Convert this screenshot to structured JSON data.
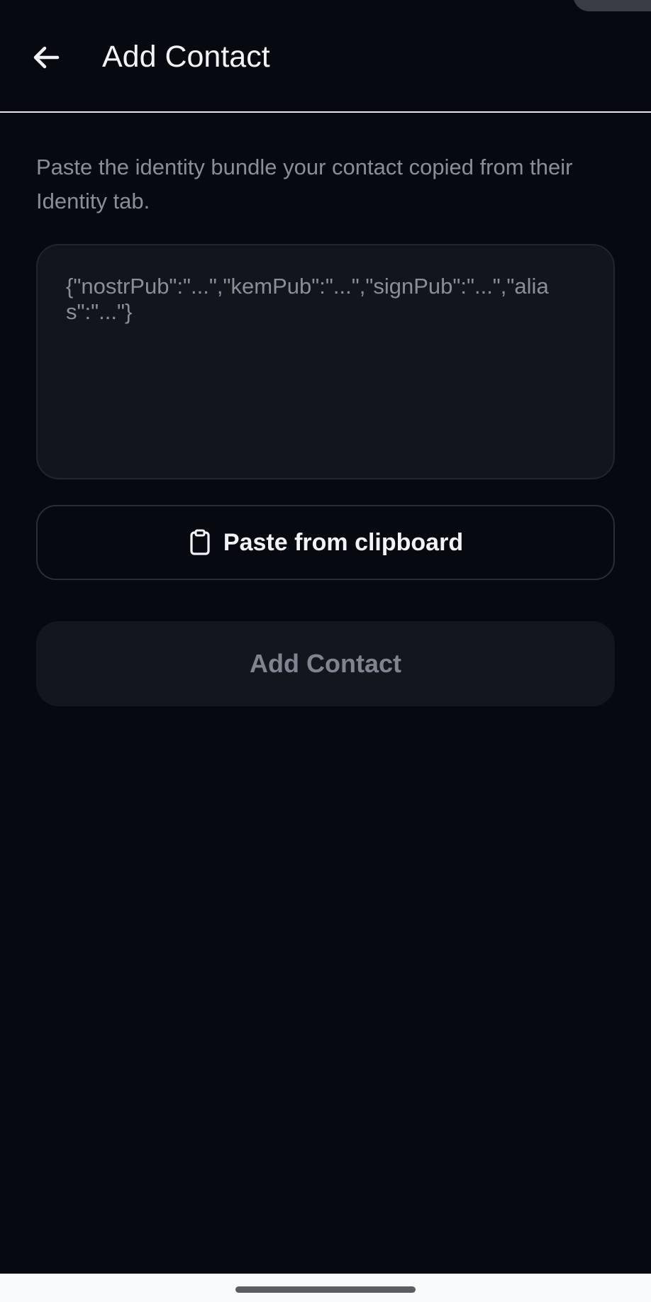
{
  "app_bar": {
    "title": "Add Contact",
    "back_icon": "arrow-left-icon"
  },
  "description": "Paste the identity bundle your contact copied from their Identity tab.",
  "bundle_input": {
    "value": "",
    "placeholder": "{\"nostrPub\":\"...\",\"kemPub\":\"...\",\"signPub\":\"...\",\"alias\":\"...\"}"
  },
  "paste_button": {
    "label": "Paste from clipboard",
    "icon": "clipboard-icon"
  },
  "add_button": {
    "label": "Add Contact",
    "enabled": false
  },
  "colors": {
    "background": "#070910",
    "surface": "#13151d",
    "text_primary": "#f2f3f6",
    "text_secondary": "#8a8e99",
    "disabled_text": "#80848f",
    "divider": "#e5e6ea"
  }
}
